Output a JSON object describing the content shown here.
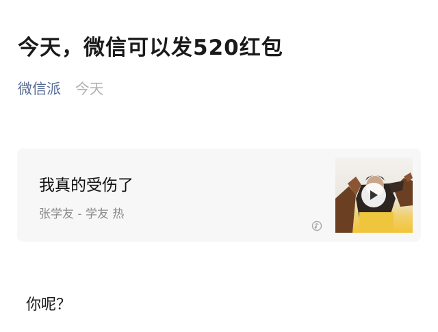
{
  "article": {
    "title": "今天，微信可以发520红包",
    "account_name": "微信派",
    "date": "今天",
    "body_text": "你呢？"
  },
  "music_card": {
    "song_title": "我真的受伤了",
    "artist_line": "张学友 - 学友 热",
    "source_icon": "qq-music-icon",
    "cover_icon": "album-cover",
    "play_icon": "play-icon"
  },
  "colors": {
    "account_link": "#576b95",
    "date_gray": "#b2b2b2",
    "card_background": "#f7f7f7"
  }
}
